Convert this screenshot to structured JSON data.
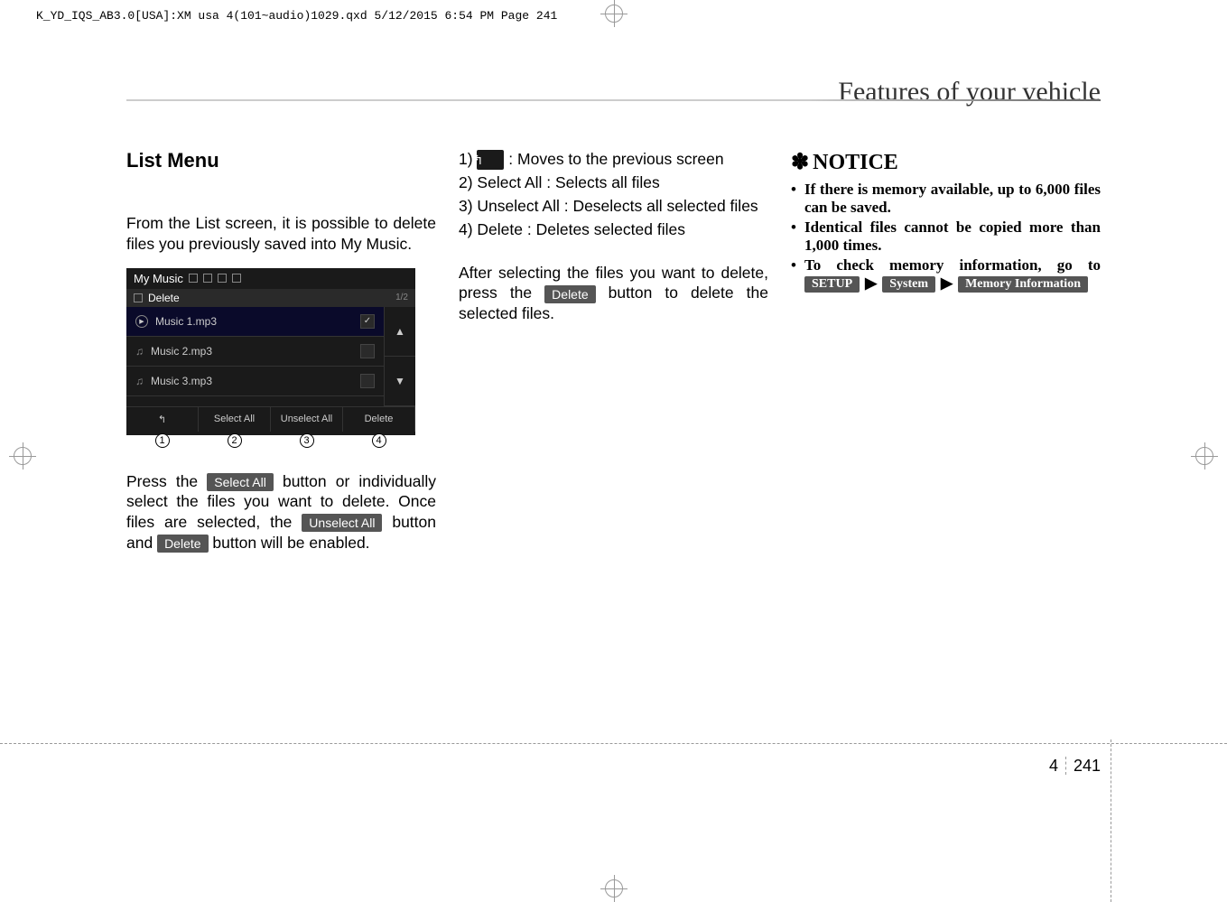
{
  "header_line": "K_YD_IQS_AB3.0[USA]:XM usa 4(101~audio)1029.qxd  5/12/2015  6:54 PM  Page 241",
  "page_title": "Features of your vehicle",
  "col1": {
    "heading": "List Menu",
    "intro": "From the List screen, it is possible to delete files you previously saved into My Music.",
    "para2_a": "Press the ",
    "para2_btn1": "Select All",
    "para2_b": " button or individually select the files you want to delete. Once files are selected, the ",
    "para2_btn2": "Unselect All",
    "para2_c": " button and ",
    "para2_btn3": "Delete",
    "para2_d": " button will be enabled."
  },
  "screenshot": {
    "title": "My Music",
    "header": "Delete",
    "pager": "1/2",
    "items": [
      "Music 1.mp3",
      "Music 2.mp3",
      "Music 3.mp3"
    ],
    "footer": [
      "↰",
      "Select All",
      "Unselect All",
      "Delete"
    ],
    "arrow_up": "▲",
    "arrow_down": "▼",
    "numbers": [
      "1",
      "2",
      "3",
      "4"
    ]
  },
  "col2": {
    "item1_a": "1) ",
    "item1_b": " : Moves to the previous screen",
    "item2": "2) Select All : Selects all files",
    "item3": "3) Unselect All : Deselects all selected files",
    "item4": "4) Delete : Deletes selected files",
    "after_a": "After selecting the files you want to delete, press the ",
    "after_btn": "Delete",
    "after_b": " button to delete the selected files.",
    "back_icon": "↰"
  },
  "col3": {
    "notice_star": "✽",
    "notice_title": "NOTICE",
    "bullet1": "If there is memory available, up to 6,000 files can be saved.",
    "bullet2": "Identical files cannot be copied more than 1,000 times.",
    "bullet3_a": "To check memory information, go to ",
    "bullet3_btn1": "SETUP",
    "bullet3_btn2": "System",
    "bullet3_btn3": "Memory Information",
    "arrow": "▶"
  },
  "footer": {
    "chapter": "4",
    "page": "241"
  }
}
